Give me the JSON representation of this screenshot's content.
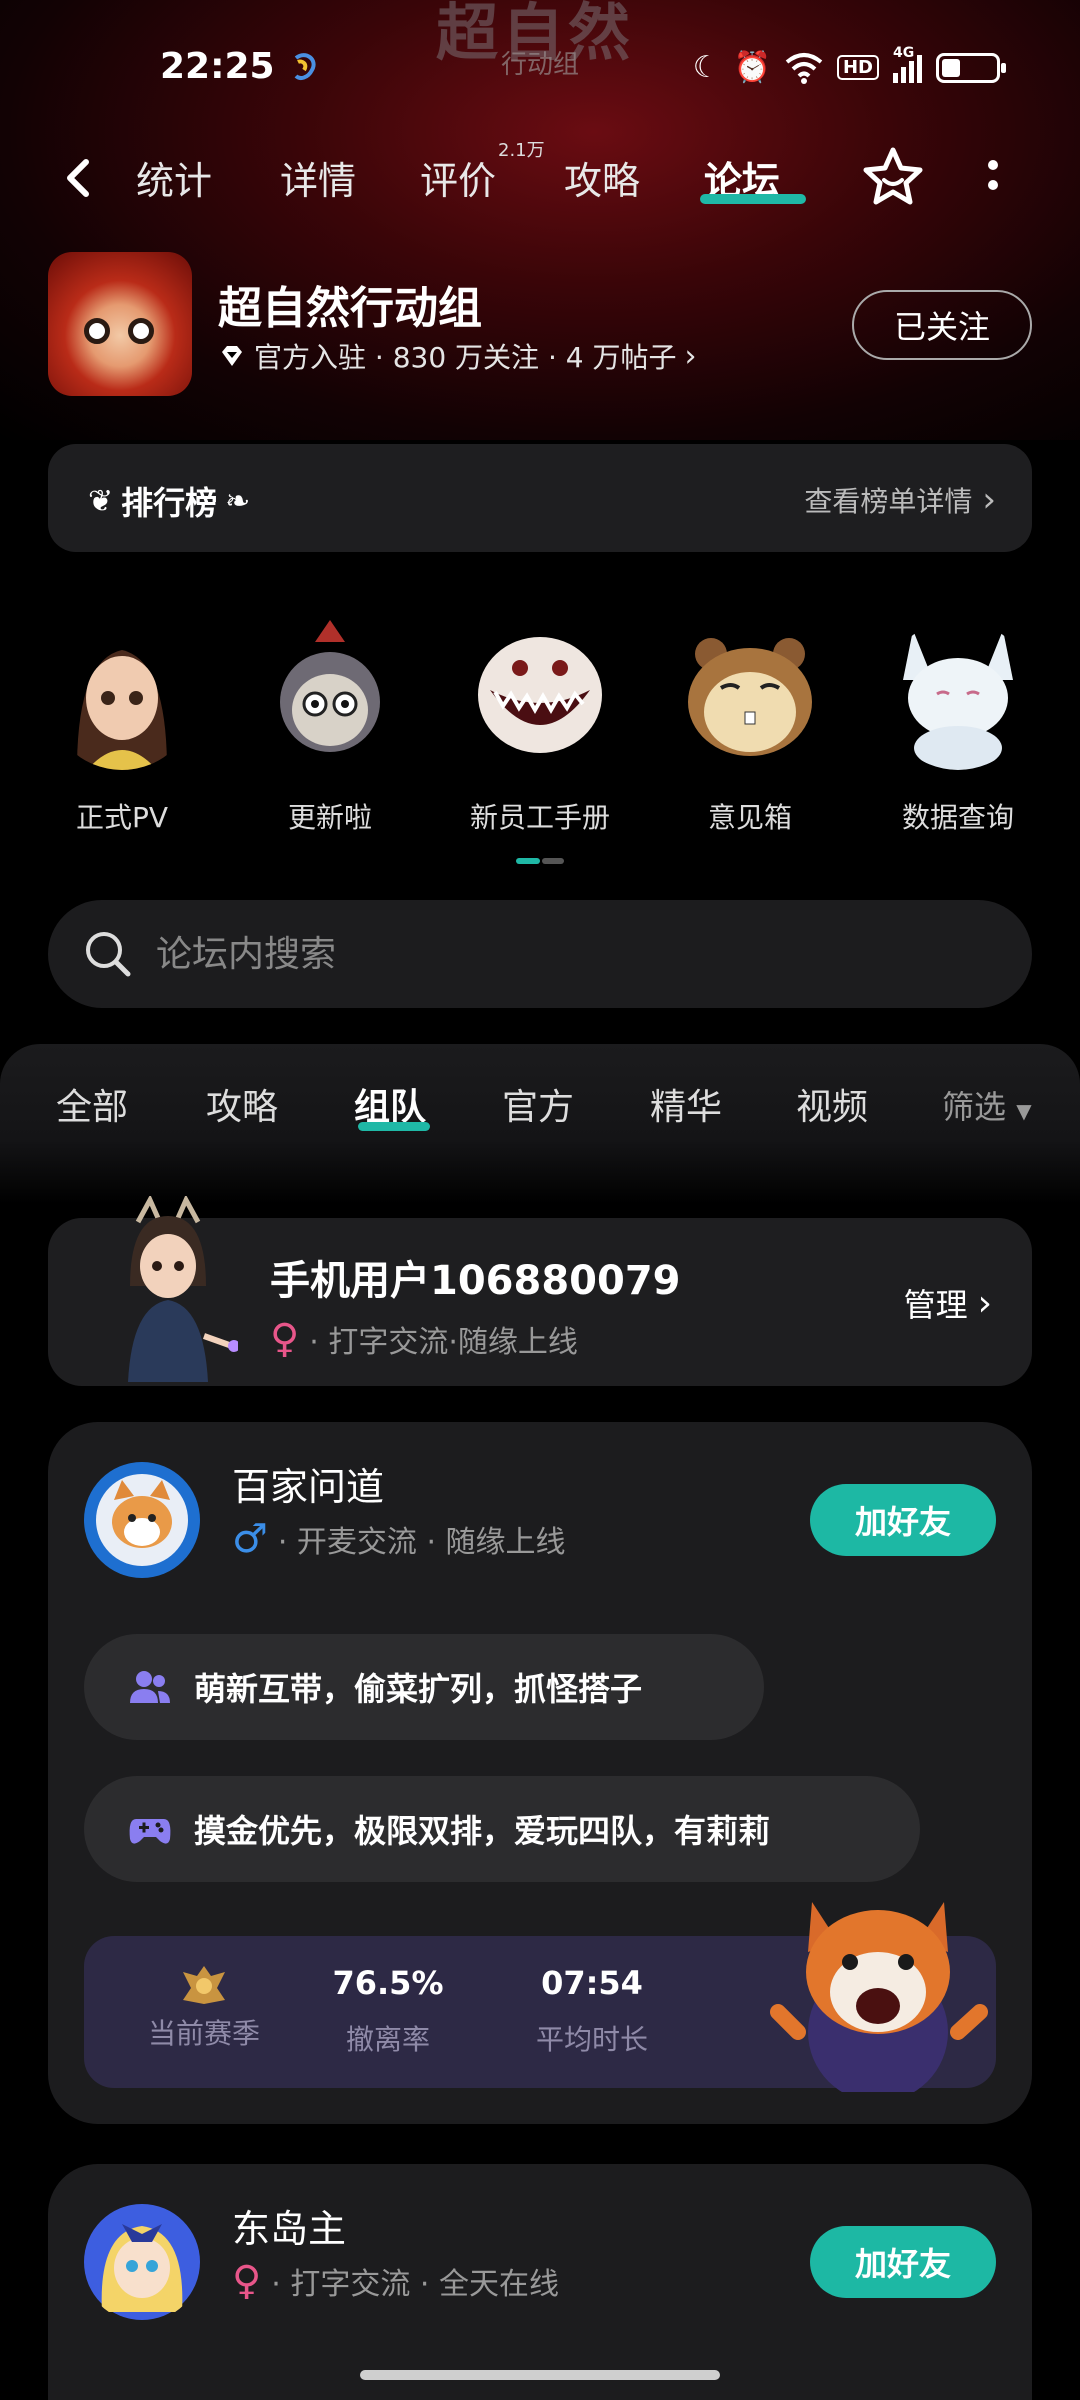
{
  "status": {
    "time": "22:25",
    "network": "4G",
    "hd": "HD",
    "battery_level": 0.35
  },
  "hero": {
    "logo_text": "超自然",
    "logo_sub": "行动组"
  },
  "nav": {
    "tabs": [
      "统计",
      "详情",
      "评价",
      "攻略",
      "论坛"
    ],
    "active": "论坛",
    "review_badge": "2.1万"
  },
  "game": {
    "title": "超自然行动组",
    "meta": "官方入驻 · 830 万关注 · 4 万帖子",
    "follow_label": "已关注"
  },
  "ranking": {
    "title": "排行榜",
    "link": "查看榜单详情"
  },
  "shortcuts": [
    {
      "label": "正式PV",
      "icon": "girl-character-icon"
    },
    {
      "label": "更新啦",
      "icon": "doll-character-icon"
    },
    {
      "label": "新员工手册",
      "icon": "monster-character-icon"
    },
    {
      "label": "意见箱",
      "icon": "hamster-character-icon"
    },
    {
      "label": "数据查询",
      "icon": "fox-character-icon"
    }
  ],
  "search": {
    "placeholder": "论坛内搜索"
  },
  "categories": {
    "tabs": [
      "全部",
      "攻略",
      "组队",
      "官方",
      "精华",
      "视频"
    ],
    "active": "组队",
    "filter": "筛选"
  },
  "me": {
    "name": "手机用户106880079",
    "desc": "· 打字交流·随缘上线",
    "gender": "female",
    "manage": "管理"
  },
  "team_posts": [
    {
      "name": "百家问道",
      "desc": "· 开麦交流 · 随缘上线",
      "gender": "male",
      "add_label": "加好友",
      "bubbles": [
        "萌新互带，偷菜扩列，抓怪搭子",
        "摸金优先，极限双排，爱玩四队，有莉莉"
      ],
      "stats": [
        {
          "value": "",
          "label": "当前赛季"
        },
        {
          "value": "76.5%",
          "label": "撤离率"
        },
        {
          "value": "07:54",
          "label": "平均时长"
        }
      ]
    },
    {
      "name": "东岛主",
      "desc": "· 打字交流 · 全天在线",
      "gender": "female",
      "add_label": "加好友"
    }
  ],
  "colors": {
    "accent": "#1fb8a6",
    "card": "#1c1c1e",
    "female": "#e8568a",
    "male": "#3b8ee8"
  }
}
